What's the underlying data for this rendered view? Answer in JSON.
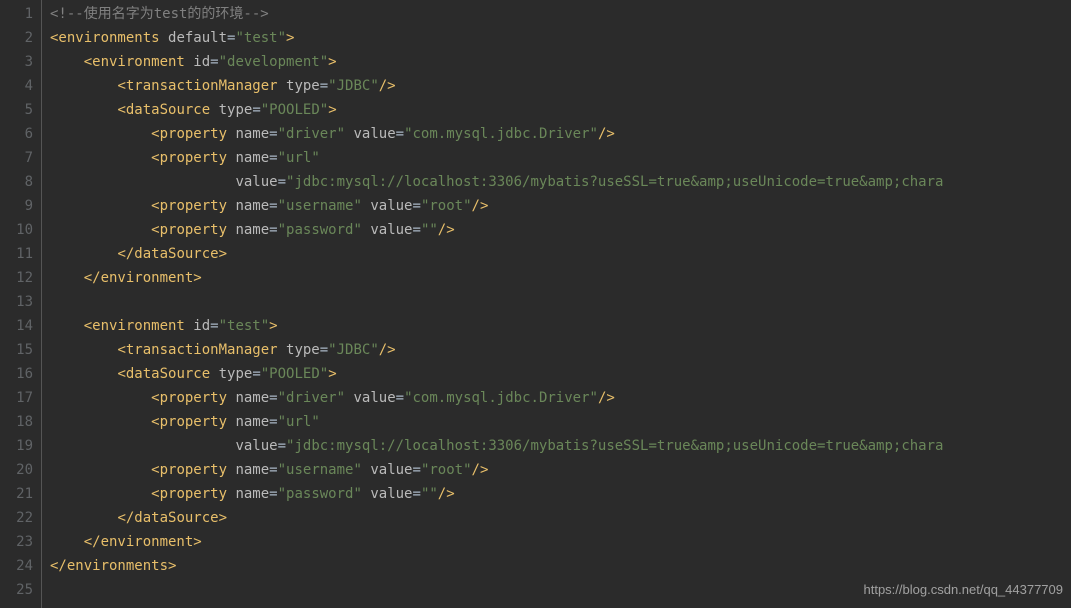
{
  "watermark": "https://blog.csdn.net/qq_44377709",
  "lines": {
    "count": 25,
    "tokens": [
      [
        {
          "c": "comment",
          "t": "<!--使用名字为test的的环境-->"
        }
      ],
      [
        {
          "c": "tag",
          "t": "<environments "
        },
        {
          "c": "attr",
          "t": "default"
        },
        {
          "c": "eq",
          "t": "="
        },
        {
          "c": "val",
          "t": "\"test\""
        },
        {
          "c": "tag",
          "t": ">"
        }
      ],
      [
        {
          "c": "",
          "t": "    "
        },
        {
          "c": "tag",
          "t": "<environment "
        },
        {
          "c": "attr",
          "t": "id"
        },
        {
          "c": "eq",
          "t": "="
        },
        {
          "c": "val",
          "t": "\"development\""
        },
        {
          "c": "tag",
          "t": ">"
        }
      ],
      [
        {
          "c": "",
          "t": "        "
        },
        {
          "c": "tag",
          "t": "<transactionManager "
        },
        {
          "c": "attr",
          "t": "type"
        },
        {
          "c": "eq",
          "t": "="
        },
        {
          "c": "val",
          "t": "\"JDBC\""
        },
        {
          "c": "tag",
          "t": "/>"
        }
      ],
      [
        {
          "c": "",
          "t": "        "
        },
        {
          "c": "tag",
          "t": "<dataSource "
        },
        {
          "c": "attr",
          "t": "type"
        },
        {
          "c": "eq",
          "t": "="
        },
        {
          "c": "val",
          "t": "\"POOLED\""
        },
        {
          "c": "tag",
          "t": ">"
        }
      ],
      [
        {
          "c": "",
          "t": "            "
        },
        {
          "c": "tag",
          "t": "<property "
        },
        {
          "c": "attr",
          "t": "name"
        },
        {
          "c": "eq",
          "t": "="
        },
        {
          "c": "val",
          "t": "\"driver\""
        },
        {
          "c": "",
          "t": " "
        },
        {
          "c": "attr",
          "t": "value"
        },
        {
          "c": "eq",
          "t": "="
        },
        {
          "c": "val",
          "t": "\"com.mysql.jdbc.Driver\""
        },
        {
          "c": "tag",
          "t": "/>"
        }
      ],
      [
        {
          "c": "",
          "t": "            "
        },
        {
          "c": "tag",
          "t": "<property "
        },
        {
          "c": "attr",
          "t": "name"
        },
        {
          "c": "eq",
          "t": "="
        },
        {
          "c": "val",
          "t": "\"url\""
        }
      ],
      [
        {
          "c": "",
          "t": "                      "
        },
        {
          "c": "attr",
          "t": "value"
        },
        {
          "c": "eq",
          "t": "="
        },
        {
          "c": "val",
          "t": "\"jdbc:mysql://localhost:3306/mybatis?useSSL=true&amp;useUnicode=true&amp;chara"
        }
      ],
      [
        {
          "c": "",
          "t": "            "
        },
        {
          "c": "tag",
          "t": "<property "
        },
        {
          "c": "attr",
          "t": "name"
        },
        {
          "c": "eq",
          "t": "="
        },
        {
          "c": "val",
          "t": "\"username\""
        },
        {
          "c": "",
          "t": " "
        },
        {
          "c": "attr",
          "t": "value"
        },
        {
          "c": "eq",
          "t": "="
        },
        {
          "c": "val",
          "t": "\"root\""
        },
        {
          "c": "tag",
          "t": "/>"
        }
      ],
      [
        {
          "c": "",
          "t": "            "
        },
        {
          "c": "tag",
          "t": "<property "
        },
        {
          "c": "attr",
          "t": "name"
        },
        {
          "c": "eq",
          "t": "="
        },
        {
          "c": "val",
          "t": "\"password\""
        },
        {
          "c": "",
          "t": " "
        },
        {
          "c": "attr",
          "t": "value"
        },
        {
          "c": "eq",
          "t": "="
        },
        {
          "c": "val",
          "t": "\"\""
        },
        {
          "c": "tag",
          "t": "/>"
        }
      ],
      [
        {
          "c": "",
          "t": "        "
        },
        {
          "c": "tag",
          "t": "</dataSource>"
        }
      ],
      [
        {
          "c": "",
          "t": "    "
        },
        {
          "c": "tag",
          "t": "</environment>"
        }
      ],
      [],
      [
        {
          "c": "",
          "t": "    "
        },
        {
          "c": "tag",
          "t": "<environment "
        },
        {
          "c": "attr",
          "t": "id"
        },
        {
          "c": "eq",
          "t": "="
        },
        {
          "c": "val",
          "t": "\"test\""
        },
        {
          "c": "tag",
          "t": ">"
        }
      ],
      [
        {
          "c": "",
          "t": "        "
        },
        {
          "c": "tag",
          "t": "<transactionManager "
        },
        {
          "c": "attr",
          "t": "type"
        },
        {
          "c": "eq",
          "t": "="
        },
        {
          "c": "val",
          "t": "\"JDBC\""
        },
        {
          "c": "tag",
          "t": "/>"
        }
      ],
      [
        {
          "c": "",
          "t": "        "
        },
        {
          "c": "tag",
          "t": "<dataSource "
        },
        {
          "c": "attr",
          "t": "type"
        },
        {
          "c": "eq",
          "t": "="
        },
        {
          "c": "val",
          "t": "\"POOLED\""
        },
        {
          "c": "tag",
          "t": ">"
        }
      ],
      [
        {
          "c": "",
          "t": "            "
        },
        {
          "c": "tag",
          "t": "<property "
        },
        {
          "c": "attr",
          "t": "name"
        },
        {
          "c": "eq",
          "t": "="
        },
        {
          "c": "val",
          "t": "\"driver\""
        },
        {
          "c": "",
          "t": " "
        },
        {
          "c": "attr",
          "t": "value"
        },
        {
          "c": "eq",
          "t": "="
        },
        {
          "c": "val",
          "t": "\"com.mysql.jdbc.Driver\""
        },
        {
          "c": "tag",
          "t": "/>"
        }
      ],
      [
        {
          "c": "",
          "t": "            "
        },
        {
          "c": "tag",
          "t": "<property "
        },
        {
          "c": "attr",
          "t": "name"
        },
        {
          "c": "eq",
          "t": "="
        },
        {
          "c": "val",
          "t": "\"url\""
        }
      ],
      [
        {
          "c": "",
          "t": "                      "
        },
        {
          "c": "attr",
          "t": "value"
        },
        {
          "c": "eq",
          "t": "="
        },
        {
          "c": "val",
          "t": "\"jdbc:mysql://localhost:3306/mybatis?useSSL=true&amp;useUnicode=true&amp;chara"
        }
      ],
      [
        {
          "c": "",
          "t": "            "
        },
        {
          "c": "tag",
          "t": "<property "
        },
        {
          "c": "attr",
          "t": "name"
        },
        {
          "c": "eq",
          "t": "="
        },
        {
          "c": "val",
          "t": "\"username\""
        },
        {
          "c": "",
          "t": " "
        },
        {
          "c": "attr",
          "t": "value"
        },
        {
          "c": "eq",
          "t": "="
        },
        {
          "c": "val",
          "t": "\"root\""
        },
        {
          "c": "tag",
          "t": "/>"
        }
      ],
      [
        {
          "c": "",
          "t": "            "
        },
        {
          "c": "tag",
          "t": "<property "
        },
        {
          "c": "attr",
          "t": "name"
        },
        {
          "c": "eq",
          "t": "="
        },
        {
          "c": "val",
          "t": "\"password\""
        },
        {
          "c": "",
          "t": " "
        },
        {
          "c": "attr",
          "t": "value"
        },
        {
          "c": "eq",
          "t": "="
        },
        {
          "c": "val",
          "t": "\"\""
        },
        {
          "c": "tag",
          "t": "/>"
        }
      ],
      [
        {
          "c": "",
          "t": "        "
        },
        {
          "c": "tag",
          "t": "</dataSource>"
        }
      ],
      [
        {
          "c": "",
          "t": "    "
        },
        {
          "c": "tag",
          "t": "</environment>"
        }
      ],
      [
        {
          "c": "tag",
          "t": "</environments>"
        }
      ],
      []
    ]
  }
}
